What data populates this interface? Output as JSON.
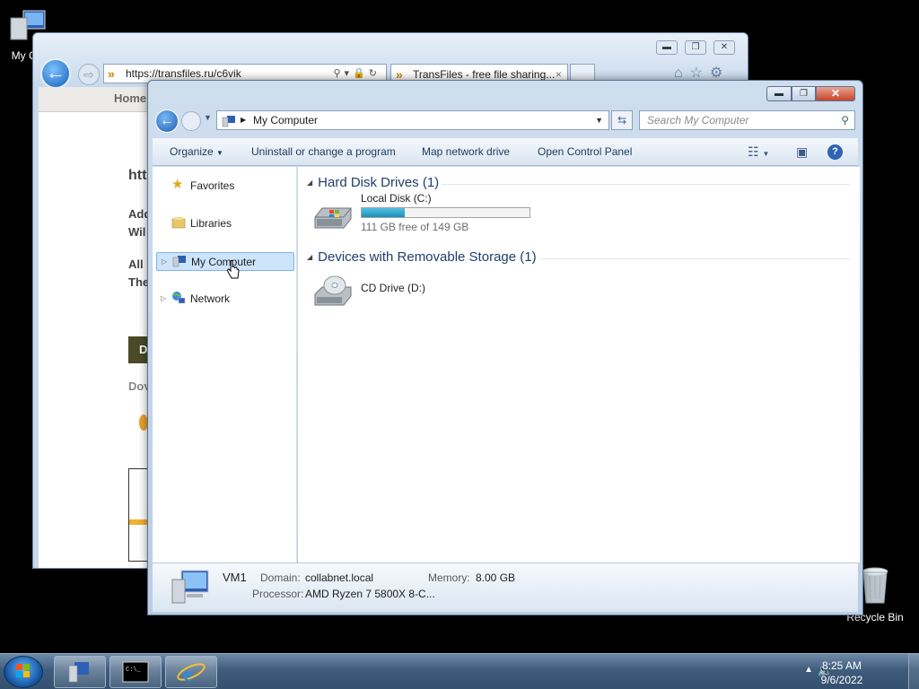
{
  "desktop": {
    "my_computer_label": "My Co",
    "recycle_bin_label": "Recycle Bin"
  },
  "browser": {
    "url": "https://transfiles.ru/c6vik",
    "tab_title": "TransFiles - free file sharing...",
    "tab_close": "×",
    "nav_home": "Home",
    "frag_htt": "htt",
    "frag_add": "Add",
    "frag_wil": "Wil",
    "frag_all": "All",
    "frag_the": "The",
    "frag_d": "D",
    "frag_dov": "Dov"
  },
  "explorer": {
    "breadcrumb": "My Computer",
    "search_placeholder": "Search My Computer",
    "commands": {
      "organize": "Organize",
      "uninstall": "Uninstall or change a program",
      "map_drive": "Map network drive",
      "control_panel": "Open Control Panel"
    },
    "nav": {
      "favorites": "Favorites",
      "libraries": "Libraries",
      "my_computer": "My Computer",
      "network": "Network"
    },
    "groups": {
      "hdd": "Hard Disk Drives (1)",
      "removable": "Devices with Removable Storage (1)"
    },
    "drives": {
      "c_name": "Local Disk (C:)",
      "c_free": "111 GB free of 149 GB",
      "c_used_fraction": 0.255,
      "d_name": "CD Drive (D:)"
    },
    "details": {
      "name": "VM1",
      "domain_label": "Domain:",
      "domain_value": "collabnet.local",
      "memory_label": "Memory:",
      "memory_value": "8.00 GB",
      "processor_label": "Processor:",
      "processor_value": "AMD Ryzen 7 5800X 8-C..."
    }
  },
  "taskbar": {
    "time": "8:25 AM",
    "date": "9/6/2022"
  },
  "colors": {
    "selection": "#cde4fb",
    "group_header": "#1e3f6a",
    "drive_bar": "#1c8fb9"
  }
}
